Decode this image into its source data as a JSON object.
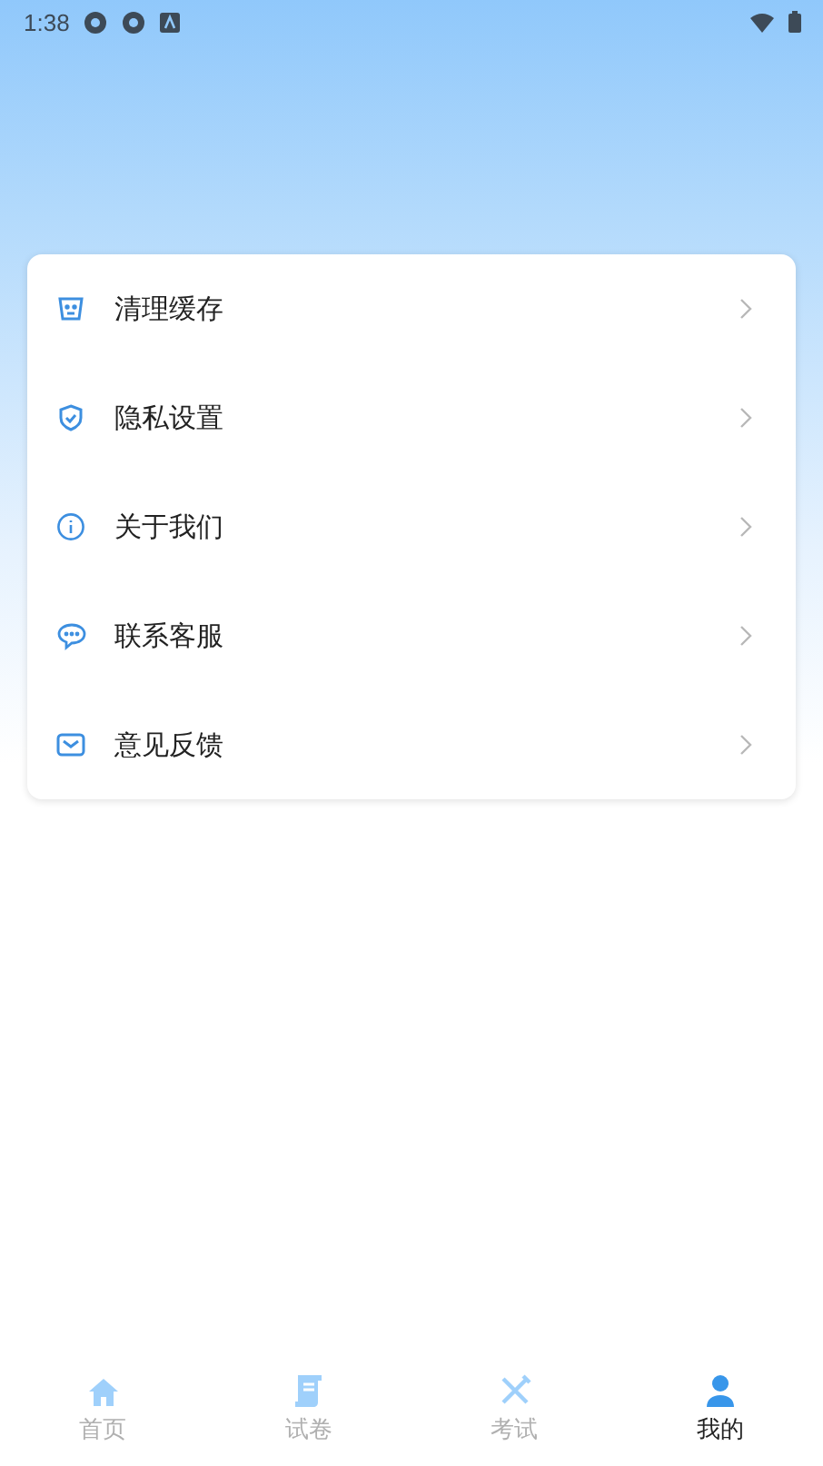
{
  "status_bar": {
    "time": "1:38"
  },
  "menu": [
    {
      "kind": "trash",
      "label": "清理缓存"
    },
    {
      "kind": "shield",
      "label": "隐私设置"
    },
    {
      "kind": "info",
      "label": "关于我们"
    },
    {
      "kind": "chat",
      "label": "联系客服"
    },
    {
      "kind": "mail",
      "label": "意见反馈"
    }
  ],
  "tabs": [
    {
      "kind": "home",
      "label": "首页",
      "selected": false
    },
    {
      "kind": "paper",
      "label": "试卷",
      "selected": false
    },
    {
      "kind": "pencil",
      "label": "考试",
      "selected": false
    },
    {
      "kind": "person",
      "label": "我的",
      "selected": true
    }
  ]
}
